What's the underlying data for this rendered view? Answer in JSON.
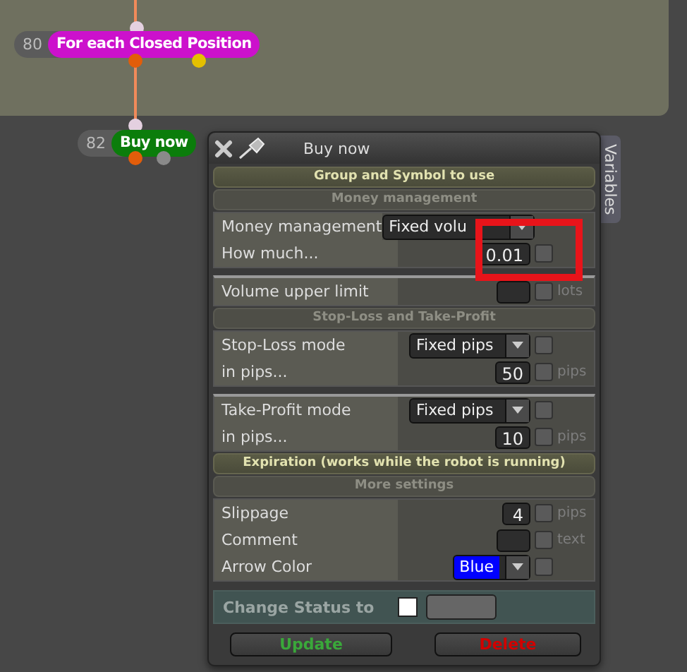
{
  "canvas": {
    "nodes": [
      {
        "number": "80",
        "label": "For each Closed Position",
        "color": "#cc11cc"
      },
      {
        "number": "82",
        "label": "Buy now",
        "color": "#0b7d0b"
      }
    ]
  },
  "dialog": {
    "title": "Buy now",
    "side_tab": "Variables",
    "sections": [
      {
        "heading": "Group and Symbol to use",
        "kind": "group"
      },
      {
        "heading": "Money management",
        "kind": "subgroup",
        "groups": [
          [
            {
              "label": "Money management",
              "kind": "dropdown",
              "value": "Fixed volu"
            },
            {
              "label": "How much...",
              "kind": "number",
              "value": "0.01",
              "checked": false
            }
          ],
          [
            {
              "label": "Volume upper limit",
              "kind": "number",
              "unit": "lots",
              "checked": false
            }
          ]
        ]
      },
      {
        "heading": "Stop-Loss and Take-Profit",
        "kind": "subgroup",
        "groups": [
          [
            {
              "label": "Stop-Loss mode",
              "kind": "dropdown",
              "value": "Fixed pips",
              "checked": false
            },
            {
              "label": "in pips...",
              "kind": "number",
              "value": "50",
              "unit": "pips",
              "checked": false
            }
          ],
          [
            {
              "label": "Take-Profit mode",
              "kind": "dropdown",
              "value": "Fixed pips",
              "checked": false
            },
            {
              "label": "in pips...",
              "kind": "number",
              "value": "10",
              "unit": "pips",
              "checked": false
            }
          ]
        ]
      },
      {
        "heading": "Expiration (works while the robot is running)",
        "kind": "group"
      },
      {
        "heading": "More settings",
        "kind": "subgroup",
        "groups": [
          [
            {
              "label": "Slippage",
              "kind": "number",
              "value": "4",
              "unit": "pips",
              "checked": false
            },
            {
              "label": "Comment",
              "kind": "number",
              "unit": "text",
              "checked": false
            },
            {
              "label": "Arrow Color",
              "kind": "color",
              "value": "Blue",
              "color": "#0000ff",
              "checked": false
            }
          ]
        ]
      }
    ],
    "status": {
      "label": "Change Status to",
      "checked": false
    },
    "buttons": [
      {
        "label": "Update",
        "kind": "update"
      },
      {
        "label": "Delete",
        "kind": "delete"
      }
    ]
  }
}
